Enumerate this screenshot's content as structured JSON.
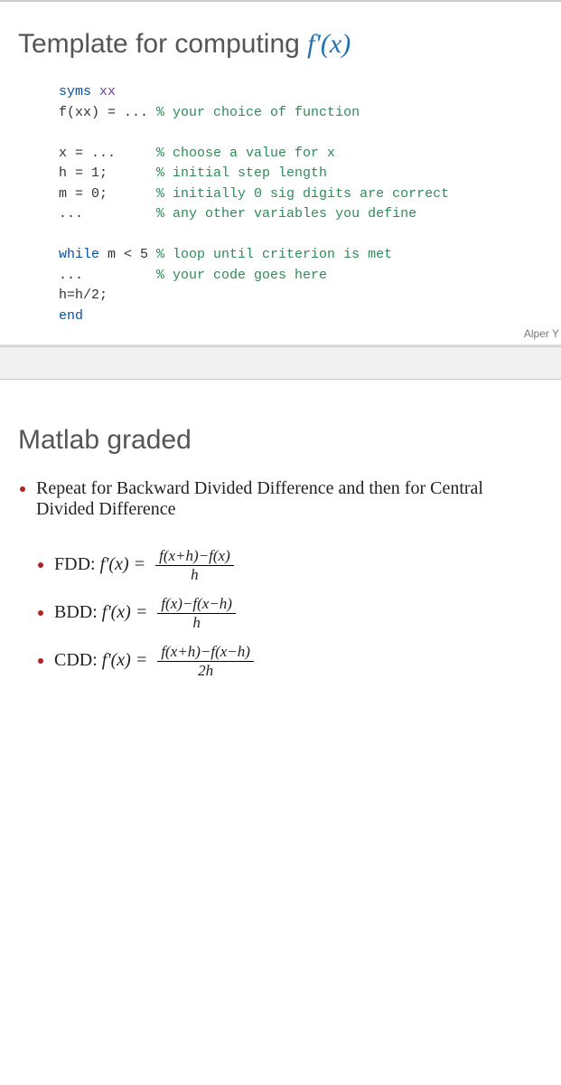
{
  "slide1": {
    "title_text": "Template for computing ",
    "title_func": "f'(x)",
    "code": {
      "l1a": "syms",
      "l1b": " xx",
      "l2a": "f(xx) = ... ",
      "l2b": "% your choice of function",
      "l3": " ",
      "l4a": "x = ...     ",
      "l4b": "% choose a value for x",
      "l5a": "h = 1;      ",
      "l5b": "% initial step length",
      "l6a": "m = 0;      ",
      "l6b": "% initially 0 sig digits are correct",
      "l7a": "...         ",
      "l7b": "% any other variables you define",
      "l8": " ",
      "l9a": "while",
      "l9b": " m < 5 ",
      "l9c": "% loop until criterion is met",
      "l10a": "...         ",
      "l10b": "% your code goes here",
      "l11": "h=h/2;",
      "l12": "end"
    },
    "byline": "Alper Y"
  },
  "slide2": {
    "title": "Matlab graded",
    "bullet1": "Repeat for Backward Divided Difference and then for Central Divided Difference",
    "formulas": {
      "fdd_label": "FDD: ",
      "bdd_label": "BDD: ",
      "cdd_label": "CDD: ",
      "lhs": "f'(x) = ",
      "fdd_num": "f(x+h)−f(x)",
      "fdd_den": "h",
      "bdd_num": "f(x)−f(x−h)",
      "bdd_den": "h",
      "cdd_num": "f(x+h)−f(x−h)",
      "cdd_den": "2h"
    }
  }
}
